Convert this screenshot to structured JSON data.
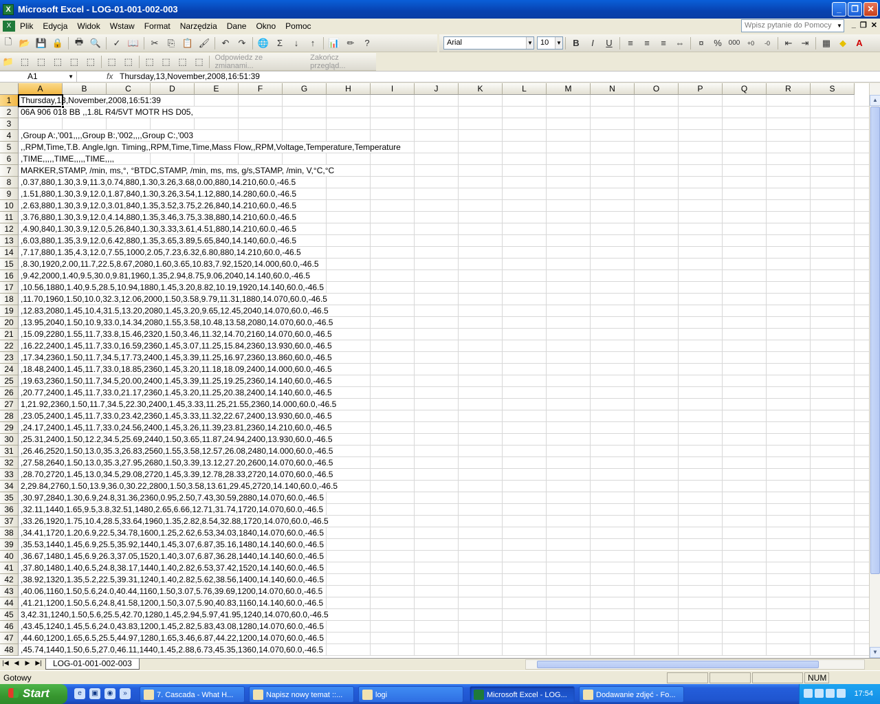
{
  "window": {
    "title": "Microsoft Excel - LOG-01-001-002-003"
  },
  "menu": [
    "Plik",
    "Edycja",
    "Widok",
    "Wstaw",
    "Format",
    "Narzędzia",
    "Dane",
    "Okno",
    "Pomoc"
  ],
  "help_placeholder": "Wpisz pytanie do Pomocy",
  "font": {
    "name": "Arial",
    "size": "10"
  },
  "review_toolbar": {
    "reply": "Odpowiedz ze zmianami...",
    "end": "Zakończ przegląd..."
  },
  "formula_bar": {
    "name_box": "A1",
    "fx": "fx",
    "value": "Thursday,13,November,2008,16:51:39"
  },
  "columns": [
    "A",
    "B",
    "C",
    "D",
    "E",
    "F",
    "G",
    "H",
    "I",
    "J",
    "K",
    "L",
    "M",
    "N",
    "O",
    "P",
    "Q",
    "R",
    "S"
  ],
  "rows": [
    {
      "n": "1",
      "text": "Thursday,13,November,2008,16:51:39"
    },
    {
      "n": "2",
      "text": "06A 906 018 BB ,,1.8L R4/5VT MOTR HS D05,"
    },
    {
      "n": "3",
      "text": ""
    },
    {
      "n": "4",
      "text": ",Group A:,'001,,,,Group B:,'002,,,,Group C:,'003"
    },
    {
      "n": "5",
      "text": ",,RPM,Time,T.B. Angle,Ign. Timing,,RPM,Time,Time,Mass Flow,,RPM,Voltage,Temperature,Temperature"
    },
    {
      "n": "6",
      "text": ",TIME,,,,,TIME,,,,,TIME,,,,"
    },
    {
      "n": "7",
      "text": "MARKER,STAMP, /min, ms,°, °BTDC,STAMP, /min, ms, ms, g/s,STAMP, /min, V,°C,°C"
    },
    {
      "n": "8",
      "text": ",0.37,880,1.30,3.9,11.3,0.74,880,1.30,3.26,3.68,0.00,880,14.210,60.0,-46.5"
    },
    {
      "n": "9",
      "text": ",1.51,880,1.30,3.9,12.0,1.87,840,1.30,3.26,3.54,1.12,880,14.280,60.0,-46.5"
    },
    {
      "n": "10",
      "text": ",2.63,880,1.30,3.9,12.0,3.01,840,1.35,3.52,3.75,2.26,840,14.210,60.0,-46.5"
    },
    {
      "n": "11",
      "text": ",3.76,880,1.30,3.9,12.0,4.14,880,1.35,3.46,3.75,3.38,880,14.210,60.0,-46.5"
    },
    {
      "n": "12",
      "text": ",4.90,840,1.30,3.9,12.0,5.26,840,1.30,3.33,3.61,4.51,880,14.210,60.0,-46.5"
    },
    {
      "n": "13",
      "text": ",6.03,880,1.35,3.9,12.0,6.42,880,1.35,3.65,3.89,5.65,840,14.140,60.0,-46.5"
    },
    {
      "n": "14",
      "text": ",7.17,880,1.35,4.3,12.0,7.55,1000,2.05,7.23,6.32,6.80,880,14.210,60.0,-46.5"
    },
    {
      "n": "15",
      "text": ",8.30,1920,2.00,11.7,22.5,8.67,2080,1.60,3.65,10.83,7.92,1520,14.000,60.0,-46.5"
    },
    {
      "n": "16",
      "text": ",9.42,2000,1.40,9.5,30.0,9.81,1960,1.35,2.94,8.75,9.06,2040,14.140,60.0,-46.5"
    },
    {
      "n": "17",
      "text": ",10.56,1880,1.40,9.5,28.5,10.94,1880,1.45,3.20,8.82,10.19,1920,14.140,60.0,-46.5"
    },
    {
      "n": "18",
      "text": ",11.70,1960,1.50,10.0,32.3,12.06,2000,1.50,3.58,9.79,11.31,1880,14.070,60.0,-46.5"
    },
    {
      "n": "19",
      "text": ",12.83,2080,1.45,10.4,31.5,13.20,2080,1.45,3.20,9.65,12.45,2040,14.070,60.0,-46.5"
    },
    {
      "n": "20",
      "text": ",13.95,2040,1.50,10.9,33.0,14.34,2080,1.55,3.58,10.48,13.58,2080,14.070,60.0,-46.5"
    },
    {
      "n": "21",
      "text": ",15.09,2280,1.55,11.7,33.8,15.46,2320,1.50,3.46,11.32,14.70,2160,14.070,60.0,-46.5"
    },
    {
      "n": "22",
      "text": ",16.22,2400,1.45,11.7,33.0,16.59,2360,1.45,3.07,11.25,15.84,2360,13.930,60.0,-46.5"
    },
    {
      "n": "23",
      "text": ",17.34,2360,1.50,11.7,34.5,17.73,2400,1.45,3.39,11.25,16.97,2360,13.860,60.0,-46.5"
    },
    {
      "n": "24",
      "text": ",18.48,2400,1.45,11.7,33.0,18.85,2360,1.45,3.20,11.18,18.09,2400,14.000,60.0,-46.5"
    },
    {
      "n": "25",
      "text": ",19.63,2360,1.50,11.7,34.5,20.00,2400,1.45,3.39,11.25,19.25,2360,14.140,60.0,-46.5"
    },
    {
      "n": "26",
      "text": ",20.77,2400,1.45,11.7,33.0,21.17,2360,1.45,3.20,11.25,20.38,2400,14.140,60.0,-46.5"
    },
    {
      "n": "27",
      "text": "1,21.92,2360,1.50,11.7,34.5,22.30,2400,1.45,3.33,11.25,21.55,2360,14.000,60.0,-46.5"
    },
    {
      "n": "28",
      "text": ",23.05,2400,1.45,11.7,33.0,23.42,2360,1.45,3.33,11.32,22.67,2400,13.930,60.0,-46.5"
    },
    {
      "n": "29",
      "text": ",24.17,2400,1.45,11.7,33.0,24.56,2400,1.45,3.26,11.39,23.81,2360,14.210,60.0,-46.5"
    },
    {
      "n": "30",
      "text": ",25.31,2400,1.50,12.2,34.5,25.69,2440,1.50,3.65,11.87,24.94,2400,13.930,60.0,-46.5"
    },
    {
      "n": "31",
      "text": ",26.46,2520,1.50,13.0,35.3,26.83,2560,1.55,3.58,12.57,26.08,2480,14.000,60.0,-46.5"
    },
    {
      "n": "32",
      "text": ",27.58,2640,1.50,13.0,35.3,27.95,2680,1.50,3.39,13.12,27.20,2600,14.070,60.0,-46.5"
    },
    {
      "n": "33",
      "text": ",28.70,2720,1.45,13.0,34.5,29.08,2720,1.45,3.39,12.78,28.33,2720,14.070,60.0,-46.5"
    },
    {
      "n": "34",
      "text": "2,29.84,2760,1.50,13.9,36.0,30.22,2800,1.50,3.58,13.61,29.45,2720,14.140,60.0,-46.5"
    },
    {
      "n": "35",
      "text": ",30.97,2840,1.30,6.9,24.8,31.36,2360,0.95,2.50,7.43,30.59,2880,14.070,60.0,-46.5"
    },
    {
      "n": "36",
      "text": ",32.11,1440,1.65,9.5,3.8,32.51,1480,2.65,6.66,12.71,31.74,1720,14.070,60.0,-46.5"
    },
    {
      "n": "37",
      "text": ",33.26,1920,1.75,10.4,28.5,33.64,1960,1.35,2.82,8.54,32.88,1720,14.070,60.0,-46.5"
    },
    {
      "n": "38",
      "text": ",34.41,1720,1.20,6.9,22.5,34.78,1600,1.25,2.62,6.53,34.03,1840,14.070,60.0,-46.5"
    },
    {
      "n": "39",
      "text": ",35.53,1440,1.45,6.9,25.5,35.92,1440,1.45,3.07,6.87,35.16,1480,14.140,60.0,-46.5"
    },
    {
      "n": "40",
      "text": ",36.67,1480,1.45,6.9,26.3,37.05,1520,1.40,3.07,6.87,36.28,1440,14.140,60.0,-46.5"
    },
    {
      "n": "41",
      "text": ",37.80,1480,1.40,6.5,24.8,38.17,1440,1.40,2.82,6.53,37.42,1520,14.140,60.0,-46.5"
    },
    {
      "n": "42",
      "text": ",38.92,1320,1.35,5.2,22.5,39.31,1240,1.40,2.82,5.62,38.56,1400,14.140,60.0,-46.5"
    },
    {
      "n": "43",
      "text": ",40.06,1160,1.50,5.6,24.0,40.44,1160,1.50,3.07,5.76,39.69,1200,14.070,60.0,-46.5"
    },
    {
      "n": "44",
      "text": ",41.21,1200,1.50,5.6,24.8,41.58,1200,1.50,3.07,5.90,40.83,1160,14.140,60.0,-46.5"
    },
    {
      "n": "45",
      "text": "3,42.31,1240,1.50,5.6,25.5,42.70,1280,1.45,2.94,5.97,41.95,1240,14.070,60.0,-46.5"
    },
    {
      "n": "46",
      "text": ",43.45,1240,1.45,5.6,24.0,43.83,1200,1.45,2.82,5.83,43.08,1280,14.070,60.0,-46.5"
    },
    {
      "n": "47",
      "text": ",44.60,1200,1.65,6.5,25.5,44.97,1280,1.65,3.46,6.87,44.22,1200,14.070,60.0,-46.5"
    },
    {
      "n": "48",
      "text": ",45.74,1440,1.50,6.5,27.0,46.11,1440,1.45,2.88,6.73,45.35,1360,14.070,60.0,-46.5"
    }
  ],
  "sheet_tab": "LOG-01-001-002-003",
  "status": {
    "ready": "Gotowy",
    "num": "NUM"
  },
  "taskbar": {
    "start": "Start",
    "tasks": [
      {
        "label": "7. Cascada - What H..."
      },
      {
        "label": "Napisz nowy temat ::..."
      },
      {
        "label": "logi"
      },
      {
        "label": "Microsoft Excel - LOG..."
      },
      {
        "label": "Dodawanie zdjęć - Fo..."
      }
    ],
    "clock": "17:54"
  }
}
